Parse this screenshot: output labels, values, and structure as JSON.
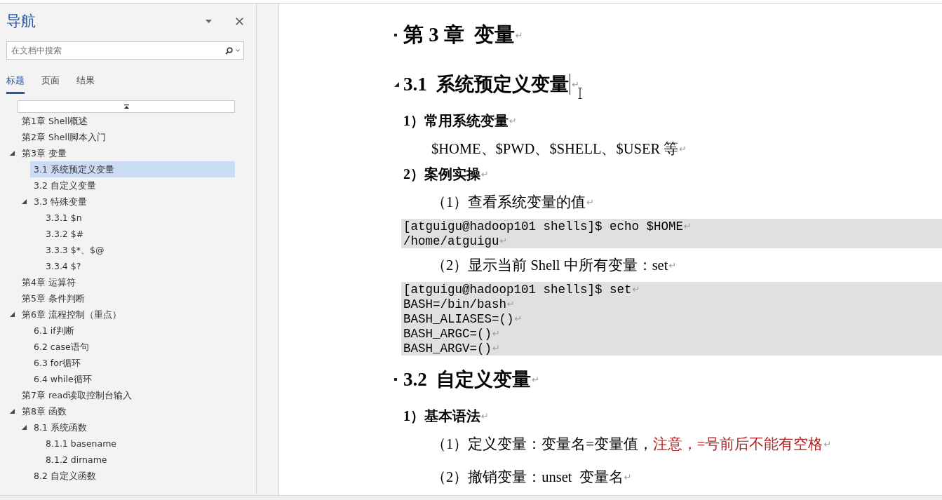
{
  "navigation": {
    "title": "导航",
    "search": {
      "placeholder": "在文档中搜索"
    },
    "tabs": [
      {
        "label": "标题",
        "selected": true
      },
      {
        "label": "页面",
        "selected": false
      },
      {
        "label": "结果",
        "selected": false
      }
    ],
    "headings": [
      {
        "label": "第1章 Shell概述",
        "selected": false
      },
      {
        "label": "第2章 Shell脚本入门",
        "selected": false
      },
      {
        "label": "第3章 变量",
        "selected": false,
        "expanded": true,
        "children": [
          {
            "label": "3.1 系统预定义变量",
            "selected": true
          },
          {
            "label": "3.2 自定义变量",
            "selected": false
          },
          {
            "label": "3.3 特殊变量",
            "selected": false,
            "expanded": true,
            "children": [
              {
                "label": "3.3.1 $n",
                "selected": false
              },
              {
                "label": "3.3.2 $#",
                "selected": false
              },
              {
                "label": "3.3.3 $*、$@",
                "selected": false
              },
              {
                "label": "3.3.4 $?",
                "selected": false
              }
            ]
          }
        ]
      },
      {
        "label": "第4章 运算符",
        "selected": false
      },
      {
        "label": "第5章 条件判断",
        "selected": false
      },
      {
        "label": "第6章 流程控制（重点）",
        "selected": false,
        "expanded": true,
        "children": [
          {
            "label": "6.1 if判断",
            "selected": false
          },
          {
            "label": "6.2 case语句",
            "selected": false
          },
          {
            "label": "6.3 for循环",
            "selected": false
          },
          {
            "label": "6.4 while循环",
            "selected": false
          }
        ]
      },
      {
        "label": "第7章 read读取控制台输入",
        "selected": false
      },
      {
        "label": "第8章 函数",
        "selected": false,
        "expanded": true,
        "children": [
          {
            "label": "8.1 系统函数",
            "selected": false,
            "expanded": true,
            "children": [
              {
                "label": "8.1.1 basename",
                "selected": false
              },
              {
                "label": "8.1.2 dirname",
                "selected": false
              }
            ]
          },
          {
            "label": "8.2 自定义函数",
            "selected": false
          }
        ]
      }
    ]
  },
  "document": {
    "blocks": [
      {
        "kind": "heading1",
        "text": "第 3 章  变量",
        "mark": "↵",
        "cursor": false
      },
      {
        "kind": "heading2",
        "text": "3.1  系统预定义变量",
        "mark": "↵",
        "cursor": true
      },
      {
        "kind": "label",
        "text": "1）常用系统变量",
        "mark": "↵"
      },
      {
        "kind": "text",
        "text": "$HOME、$PWD、$SHELL、$USER 等",
        "mark": "↵"
      },
      {
        "kind": "label",
        "text": "2）案例实操",
        "mark": "↵"
      },
      {
        "kind": "text",
        "text": "（1）查看系统变量的值",
        "mark": "↵"
      },
      {
        "kind": "code",
        "lines": [
          {
            "text": "[atguigu@hadoop101 shells]$ echo $HOME",
            "mark": "↵"
          },
          {
            "text": "/home/atguigu",
            "mark": "↵"
          }
        ]
      },
      {
        "kind": "text",
        "text": "（2）显示当前 Shell 中所有变量：set",
        "mark": "↵"
      },
      {
        "kind": "code",
        "lines": [
          {
            "text": "[atguigu@hadoop101 shells]$ set",
            "mark": "↵"
          },
          {
            "text": "BASH=/bin/bash",
            "mark": "↵"
          },
          {
            "text": "BASH_ALIASES=()",
            "mark": "↵"
          },
          {
            "text": "BASH_ARGC=()",
            "mark": "↵"
          },
          {
            "text": "BASH_ARGV=()",
            "mark": "↵"
          }
        ]
      },
      {
        "kind": "heading2",
        "text": "3.2  自定义变量",
        "mark": "↵",
        "cursor": false
      },
      {
        "kind": "label",
        "text": "1）基本语法",
        "mark": "↵"
      },
      {
        "kind": "text",
        "parts": [
          {
            "text": "（1）定义变量：变量名=变量值，",
            "color": "#000000"
          },
          {
            "text": "注意，=号前后不能有空格",
            "color": "#b22222"
          }
        ],
        "mark": "↵"
      },
      {
        "kind": "text",
        "text": "（2）撤销变量：unset  变量名",
        "mark": "↵"
      }
    ]
  }
}
